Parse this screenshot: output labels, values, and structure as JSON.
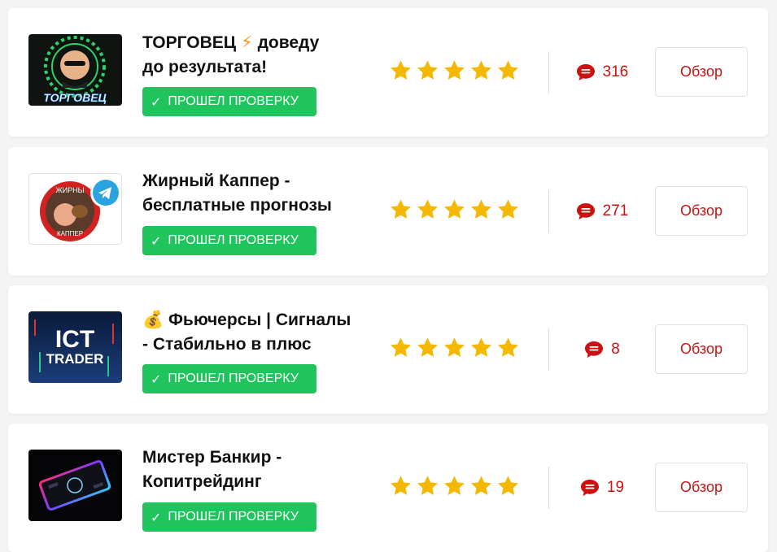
{
  "colors": {
    "badge": "#1fc45d",
    "star": "#f5b800",
    "accent": "#cc1111"
  },
  "items": [
    {
      "title_line1": "ТОРГОВЕЦ",
      "title_emoji": "⚡",
      "title_line1_end": "доведу",
      "title_line2": "до результата!",
      "badge": "ПРОШЕЛ ПРОВЕРКУ",
      "rating": 5,
      "comments": "316",
      "button": "Обзор",
      "logo_text": "ТОРГОВЕЦ"
    },
    {
      "title_line1": "Жирный Каппер -",
      "title_line2": "бесплатные прогнозы",
      "badge": "ПРОШЕЛ ПРОВЕРКУ",
      "rating": 5,
      "comments": "271",
      "button": "Обзор",
      "logo_text_top": "ЖИРНЫ",
      "logo_text_bottom": "КАППЕР",
      "logo_icon": "telegram-icon"
    },
    {
      "title_emoji": "💰",
      "title_line1": "Фьючерсы | Сигналы",
      "title_line2": "- Стабильно в плюс",
      "badge": "ПРОШЕЛ ПРОВЕРКУ",
      "rating": 5,
      "comments": "8",
      "button": "Обзор",
      "logo_text_top": "ICT",
      "logo_text_bottom": "TRADER"
    },
    {
      "title_line1": "Мистер Банкир -",
      "title_line2": "Копитрейдинг",
      "badge": "ПРОШЕЛ ПРОВЕРКУ",
      "rating": 5,
      "comments": "19",
      "button": "Обзор"
    }
  ]
}
